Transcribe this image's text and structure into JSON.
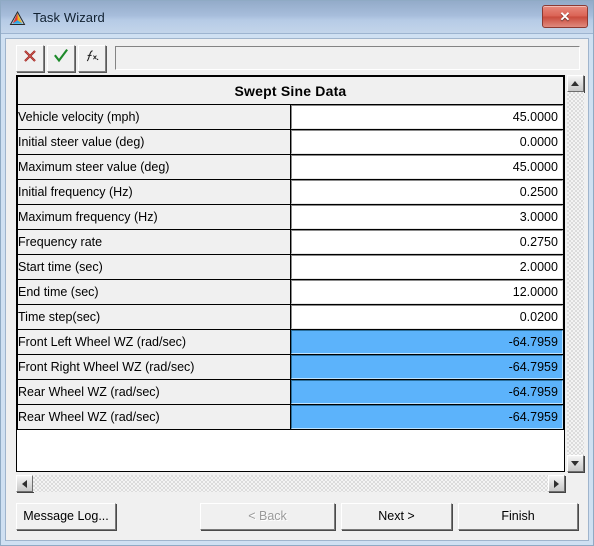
{
  "window": {
    "title": "Task Wizard",
    "icon": "triangle-logo-icon",
    "close_label": "✕",
    "border_color": "#cfe0f2",
    "titlebar_gradient_top": "#93abc9",
    "titlebar_gradient_bottom": "#c3d5ea",
    "close_button_color": "#d05244"
  },
  "toolbar": {
    "cancel_icon": "red-x-icon",
    "accept_icon": "green-check-icon",
    "function_icon": "fx-function-icon",
    "formula_value": "",
    "formula_placeholder": ""
  },
  "grid": {
    "header": "Swept Sine Data",
    "selection_color": "#5cb3fb",
    "rows": [
      {
        "label": "Vehicle velocity (mph)",
        "value": "45.0000",
        "selected": false
      },
      {
        "label": "Initial steer value (deg)",
        "value": "0.0000",
        "selected": false
      },
      {
        "label": "Maximum steer value (deg)",
        "value": "45.0000",
        "selected": false
      },
      {
        "label": "Initial frequency (Hz)",
        "value": "0.2500",
        "selected": false
      },
      {
        "label": "Maximum frequency (Hz)",
        "value": "3.0000",
        "selected": false
      },
      {
        "label": "Frequency rate",
        "value": "0.2750",
        "selected": false
      },
      {
        "label": "Start time (sec)",
        "value": "2.0000",
        "selected": false
      },
      {
        "label": "End time (sec)",
        "value": "12.0000",
        "selected": false
      },
      {
        "label": "Time step(sec)",
        "value": "0.0200",
        "selected": false
      },
      {
        "label": "Front Left Wheel WZ (rad/sec)",
        "value": "-64.7959",
        "selected": true
      },
      {
        "label": "Front Right Wheel WZ (rad/sec)",
        "value": "-64.7959",
        "selected": true
      },
      {
        "label": "Rear Wheel WZ (rad/sec)",
        "value": "-64.7959",
        "selected": true
      },
      {
        "label": "Rear Wheel WZ (rad/sec)",
        "value": "-64.7959",
        "selected": true
      }
    ]
  },
  "scrollbars": {
    "vertical_up": "scroll-up-arrow-icon",
    "vertical_down": "scroll-down-arrow-icon",
    "horizontal_left": "scroll-left-arrow-icon",
    "horizontal_right": "scroll-right-arrow-icon"
  },
  "buttons": {
    "message_log": "Message Log...",
    "back": "< Back",
    "back_disabled": true,
    "next": "Next >",
    "finish": "Finish"
  }
}
